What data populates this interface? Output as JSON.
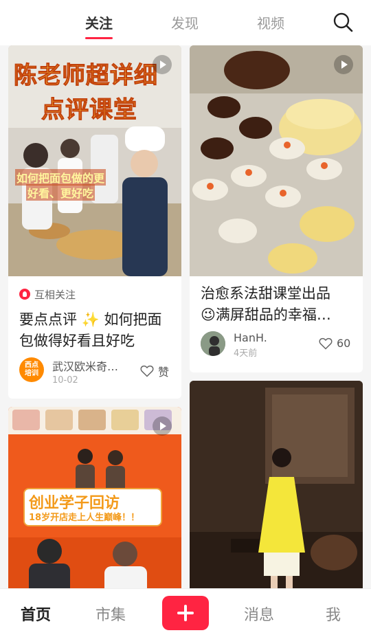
{
  "header": {
    "tabs": [
      {
        "label": "关注"
      },
      {
        "label": "发现"
      },
      {
        "label": "视频"
      }
    ]
  },
  "feed": {
    "cards": [
      {
        "thumb_line1": "陈老师超详细",
        "thumb_line2": "点评课堂",
        "thumb_caption1": "如何把面包做的更",
        "thumb_caption2": "好看、更好吃",
        "tag": "互相关注",
        "title_line1": "要点点评 ✨ 如何把面",
        "title_line2": "包做得好看且好吃",
        "author_name": "武汉欧米奇…",
        "avatar_line1": "西点",
        "avatar_line2": "培训",
        "date": "10-02",
        "like_text": "赞"
      },
      {
        "title_line1": "治愈系法甜课堂出品",
        "title_line2": "😉满屏甜品的幸福…",
        "author_name": "HanH.",
        "date": "4天前",
        "like_text": "60"
      },
      {
        "thumb_line1": "创业学子回访",
        "thumb_line2": "18岁开店走上人生巅峰！！"
      },
      {}
    ]
  },
  "bottom_nav": {
    "items": [
      {
        "label": "首页"
      },
      {
        "label": "市集"
      },
      {
        "label": "消息"
      },
      {
        "label": "我"
      }
    ]
  },
  "colors": {
    "accent": "#ff2442"
  }
}
